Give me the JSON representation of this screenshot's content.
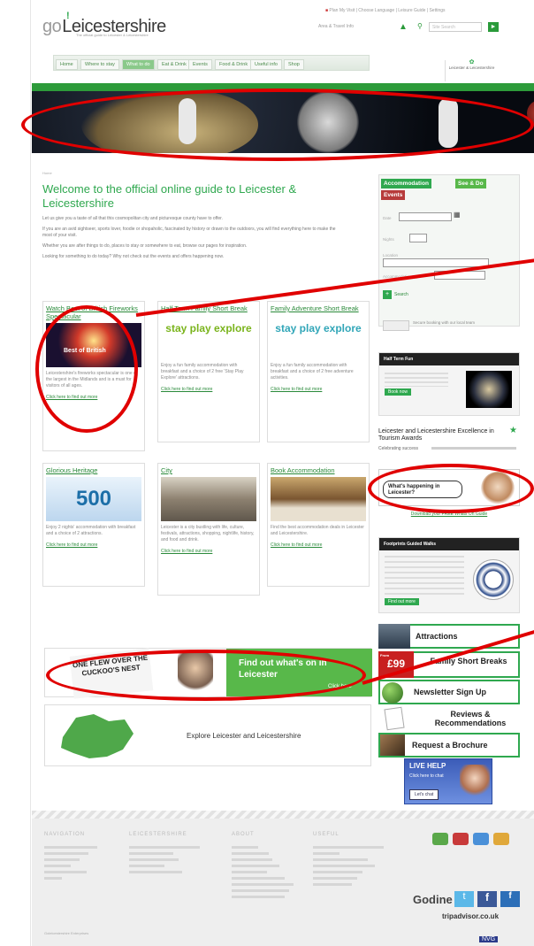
{
  "header": {
    "logo_go": "go",
    "logo_ex": "!",
    "logo_rest": "Leicestershire",
    "tagline": "The official guide to Leicester & Leicestershire",
    "toplinks": "Plan My Visit | Choose Language | Leisure Guide | Settings",
    "account_text": "Area & Travel Info",
    "search_placeholder": "Site Search",
    "search_go": "►"
  },
  "nav": {
    "items": [
      "Home",
      "Where to stay",
      "What to do",
      "Eat & Drink",
      "Events",
      "Food & Drink",
      "Useful info",
      "Shop"
    ],
    "partner": "Leicester & Leicestershire"
  },
  "main": {
    "crumb": "Home",
    "welcome": "Welcome to the official online guide to Leicester & Leicestershire",
    "intro": [
      "Let us give you a taste of all that this cosmopolitan city and picturesque county have to offer.",
      "If you are an avid sightseer, sports lover, foodie or shopaholic, fascinated by history or drawn to the outdoors, you will find everything here to make the most of your visit.",
      "Whether you are after things to do, places to stay or somewhere to eat, browse our pages for inspiration.",
      "Looking for something to do today? Why not check out the events and offers happening now."
    ],
    "cards": [
      {
        "title": "Watch Best of British Fireworks Spectacular",
        "img_text": "Best of British",
        "text": "Leicestershire's fireworks spectacular is one of the largest in the Midlands and is a must for visitors of all ages.",
        "more": "Click here to find out more"
      },
      {
        "title": "Half Term Family Short Break",
        "img_text": "stay play explore",
        "text": "Enjoy a fun family accommodation with breakfast and a choice of 2 free 'Stay Play Explore' attractions.",
        "more": "Click here to find out more"
      },
      {
        "title": "Family Adventure Short Break",
        "img_text": "stay play explore",
        "text": "Enjoy a fun family accommodation with breakfast and a choice of 2 free adventure activities.",
        "more": "Click here to find out more"
      },
      {
        "title": "Glorious Heritage",
        "img_text": "500",
        "text": "Enjoy 2 nights' accommodation with breakfast and a choice of 2 attractions.",
        "more": "Click here to find out more"
      },
      {
        "title": "City",
        "img_text": "",
        "text": "Leicester is a city bustling with life, culture, festivals, attractions, shopping, nightlife, history, and food and drink.",
        "more": "Click here to find out more"
      },
      {
        "title": "Book Accommodation",
        "img_text": "",
        "text": "Find the best accommodation deals in Leicester and Leicestershire.",
        "more": "Click here to find out more"
      }
    ],
    "banner_text": "Find out what's on in Leicester",
    "banner_more": "Click here",
    "banner_sign": "ONE FLEW OVER THE CUCKOO'S NEST",
    "explore_text": "Explore Leicester and Leicestershire"
  },
  "sidebar": {
    "tabs": [
      "Accommodation",
      "See & Do",
      "Events"
    ],
    "labels": [
      "Date",
      "Nights",
      "Location",
      "Accommodation Type"
    ],
    "search_btn": "Search",
    "book_note": "Secure booking with our local team",
    "half_term": "Half Term Fun",
    "half_term_more": "Book now",
    "award": "Leicester and Leicestershire Excellence in Tourism Awards",
    "award_sub": "Celebrating success",
    "whats_on": "What's happening in Leicester?",
    "whats_on_sub": "Download your FREE Whats On Guide",
    "retro_hdr": "Footprints Guided Walks",
    "retro_more": "Find out more",
    "attractions": "Attractions",
    "price": "£99",
    "price_pre": "From",
    "family": "Family Short Breaks",
    "newsletter": "Newsletter Sign Up",
    "reviews": "Reviews & Recommendations",
    "brochure": "Request a Brochure",
    "livehelp": "LIVE HELP",
    "livehelp_sub": "Click here to chat",
    "livehelp_btn": "Let's chat"
  },
  "footer": {
    "cols": [
      "NAVIGATION",
      "LEICESTERSHIRE",
      "ABOUT",
      "USEFUL"
    ],
    "godine": "Godine",
    "tripadvisor": "tripadvisor.co.uk",
    "copyright": "Goleicestershire Enterprises",
    "badge": "NVG"
  },
  "colors": {
    "brand": "#2fa84f",
    "annotation": "#e00000"
  }
}
